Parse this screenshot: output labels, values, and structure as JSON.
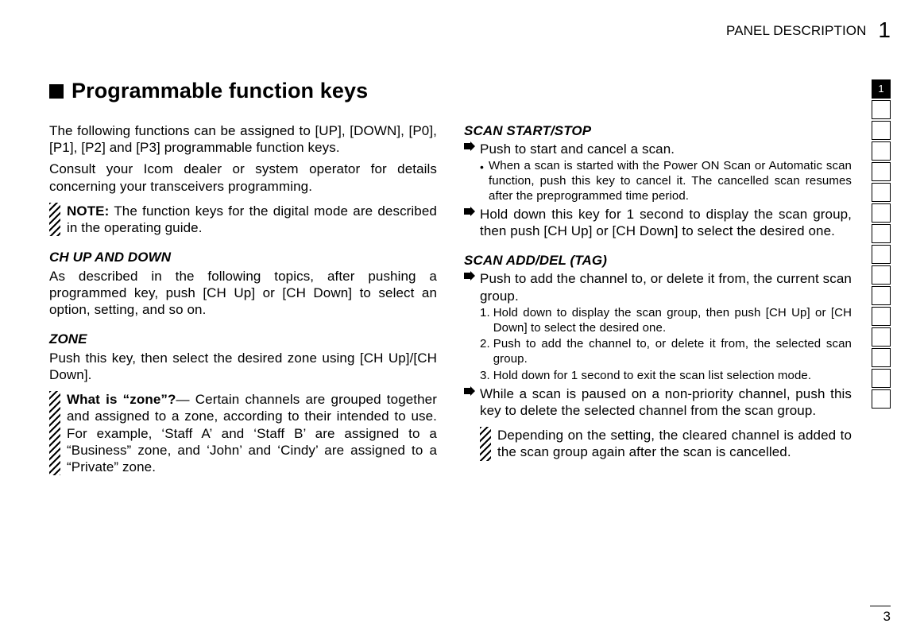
{
  "header": {
    "section_title": "PANEL DESCRIPTION",
    "chapter_number": "1"
  },
  "tabs": [
    "1",
    "",
    "",
    "",
    "",
    "",
    "",
    "",
    "",
    "",
    "",
    "",
    "",
    "",
    "",
    ""
  ],
  "heading": "Programmable function keys",
  "left": {
    "intro": [
      "The following functions can be assigned to [UP], [DOWN], [P0], [P1], [P2] and [P3] programmable function keys.",
      "Consult your Icom dealer or system operator for details concerning your transceivers programming."
    ],
    "note": {
      "label": "NOTE:",
      "text": "The function keys for the digital mode are described in the operating guide."
    },
    "ch": {
      "title": "CH UP AND DOWN",
      "text": "As described in the following topics, after pushing a programmed key, push [CH Up] or [CH Down] to select an option, setting, and so on."
    },
    "zone": {
      "title": "ZONE",
      "text": "Push this key, then select the desired zone using [CH Up]/[CH Down].",
      "what_label": "What is “zone”?",
      "what_text": "— Certain channels are grouped together and assigned to a zone, according to their intended to use. For example, ‘Staff A’ and ‘Staff B’ are assigned to a “Business” zone, and ‘John’ and ‘Cindy’ are assigned to a “Private” zone."
    }
  },
  "right": {
    "scan": {
      "title": "SCAN START/STOP",
      "arrows": [
        "Push to start and cancel a scan.",
        "Hold down this key for 1 second to display the scan group, then push [CH Up] or [CH Down] to select the desired one."
      ],
      "bullet": "When a scan is started with the Power ON Scan or Automatic scan function, push this key to cancel it. The cancelled scan resumes after the preprogrammed time period."
    },
    "tag": {
      "title": "SCAN ADD/DEL (TAG)",
      "arrow1": "Push to add the channel to, or delete it from, the current scan group.",
      "steps": [
        "Hold down to display the scan group, then push [CH Up] or [CH Down] to select the desired one.",
        "Push to add the channel to, or delete it from, the selected scan group.",
        "Hold down for 1 second to exit the scan list selection mode."
      ],
      "arrow2": "While a scan is paused on a non-priority channel, push this key to delete the selected channel from the scan group.",
      "note": "Depending on the setting, the cleared channel is added to the scan group again after the scan is cancelled."
    }
  },
  "page_number": "3"
}
